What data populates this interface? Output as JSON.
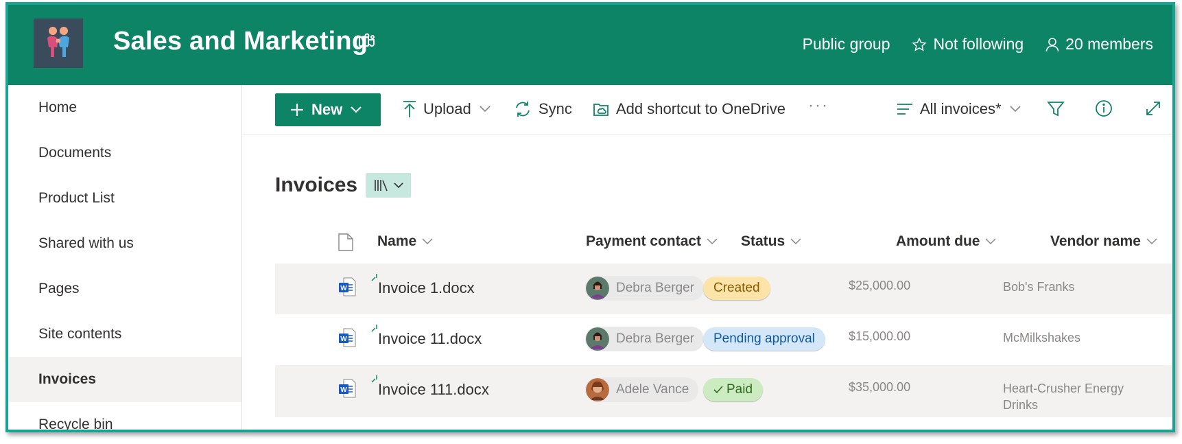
{
  "header": {
    "site_title": "Sales and Marketing",
    "privacy": "Public group",
    "follow_label": "Not following",
    "members_label": "20 members",
    "colors": {
      "brand": "#0e8466",
      "frame": "#1aa393"
    }
  },
  "nav": {
    "items": [
      {
        "label": "Home",
        "active": false
      },
      {
        "label": "Documents",
        "active": false
      },
      {
        "label": "Product List",
        "active": false
      },
      {
        "label": "Shared with us",
        "active": false
      },
      {
        "label": "Pages",
        "active": false
      },
      {
        "label": "Site contents",
        "active": false
      },
      {
        "label": "Invoices",
        "active": true
      },
      {
        "label": "Recycle bin",
        "active": false
      }
    ]
  },
  "toolbar": {
    "new_label": "New",
    "upload_label": "Upload",
    "sync_label": "Sync",
    "shortcut_label": "Add shortcut to OneDrive",
    "more_label": "···",
    "view_label": "All invoices*"
  },
  "library": {
    "title": "Invoices",
    "columns": [
      "Name",
      "Payment contact",
      "Status",
      "Amount due",
      "Vendor name"
    ],
    "rows": [
      {
        "name": "Invoice 1.docx",
        "contact": "Debra Berger",
        "status": "Created",
        "status_kind": "created",
        "amount": "$25,000.00",
        "vendor": "Bob's Franks"
      },
      {
        "name": "Invoice 11.docx",
        "contact": "Debra Berger",
        "status": "Pending approval",
        "status_kind": "pending",
        "amount": "$15,000.00",
        "vendor": "McMilkshakes"
      },
      {
        "name": "Invoice 111.docx",
        "contact": "Adele Vance",
        "status": "Paid",
        "status_kind": "paid",
        "amount": "$35,000.00",
        "vendor": "Heart-Crusher Energy Drinks"
      }
    ]
  }
}
